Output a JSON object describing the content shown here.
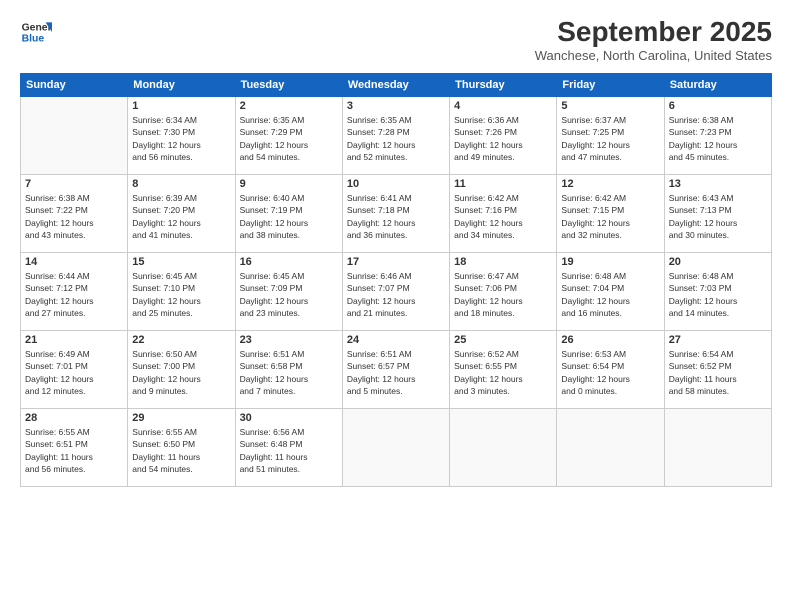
{
  "logo": {
    "line1": "General",
    "line2": "Blue"
  },
  "header": {
    "month": "September 2025",
    "location": "Wanchese, North Carolina, United States"
  },
  "weekdays": [
    "Sunday",
    "Monday",
    "Tuesday",
    "Wednesday",
    "Thursday",
    "Friday",
    "Saturday"
  ],
  "weeks": [
    [
      {
        "day": "",
        "info": ""
      },
      {
        "day": "1",
        "info": "Sunrise: 6:34 AM\nSunset: 7:30 PM\nDaylight: 12 hours\nand 56 minutes."
      },
      {
        "day": "2",
        "info": "Sunrise: 6:35 AM\nSunset: 7:29 PM\nDaylight: 12 hours\nand 54 minutes."
      },
      {
        "day": "3",
        "info": "Sunrise: 6:35 AM\nSunset: 7:28 PM\nDaylight: 12 hours\nand 52 minutes."
      },
      {
        "day": "4",
        "info": "Sunrise: 6:36 AM\nSunset: 7:26 PM\nDaylight: 12 hours\nand 49 minutes."
      },
      {
        "day": "5",
        "info": "Sunrise: 6:37 AM\nSunset: 7:25 PM\nDaylight: 12 hours\nand 47 minutes."
      },
      {
        "day": "6",
        "info": "Sunrise: 6:38 AM\nSunset: 7:23 PM\nDaylight: 12 hours\nand 45 minutes."
      }
    ],
    [
      {
        "day": "7",
        "info": "Sunrise: 6:38 AM\nSunset: 7:22 PM\nDaylight: 12 hours\nand 43 minutes."
      },
      {
        "day": "8",
        "info": "Sunrise: 6:39 AM\nSunset: 7:20 PM\nDaylight: 12 hours\nand 41 minutes."
      },
      {
        "day": "9",
        "info": "Sunrise: 6:40 AM\nSunset: 7:19 PM\nDaylight: 12 hours\nand 38 minutes."
      },
      {
        "day": "10",
        "info": "Sunrise: 6:41 AM\nSunset: 7:18 PM\nDaylight: 12 hours\nand 36 minutes."
      },
      {
        "day": "11",
        "info": "Sunrise: 6:42 AM\nSunset: 7:16 PM\nDaylight: 12 hours\nand 34 minutes."
      },
      {
        "day": "12",
        "info": "Sunrise: 6:42 AM\nSunset: 7:15 PM\nDaylight: 12 hours\nand 32 minutes."
      },
      {
        "day": "13",
        "info": "Sunrise: 6:43 AM\nSunset: 7:13 PM\nDaylight: 12 hours\nand 30 minutes."
      }
    ],
    [
      {
        "day": "14",
        "info": "Sunrise: 6:44 AM\nSunset: 7:12 PM\nDaylight: 12 hours\nand 27 minutes."
      },
      {
        "day": "15",
        "info": "Sunrise: 6:45 AM\nSunset: 7:10 PM\nDaylight: 12 hours\nand 25 minutes."
      },
      {
        "day": "16",
        "info": "Sunrise: 6:45 AM\nSunset: 7:09 PM\nDaylight: 12 hours\nand 23 minutes."
      },
      {
        "day": "17",
        "info": "Sunrise: 6:46 AM\nSunset: 7:07 PM\nDaylight: 12 hours\nand 21 minutes."
      },
      {
        "day": "18",
        "info": "Sunrise: 6:47 AM\nSunset: 7:06 PM\nDaylight: 12 hours\nand 18 minutes."
      },
      {
        "day": "19",
        "info": "Sunrise: 6:48 AM\nSunset: 7:04 PM\nDaylight: 12 hours\nand 16 minutes."
      },
      {
        "day": "20",
        "info": "Sunrise: 6:48 AM\nSunset: 7:03 PM\nDaylight: 12 hours\nand 14 minutes."
      }
    ],
    [
      {
        "day": "21",
        "info": "Sunrise: 6:49 AM\nSunset: 7:01 PM\nDaylight: 12 hours\nand 12 minutes."
      },
      {
        "day": "22",
        "info": "Sunrise: 6:50 AM\nSunset: 7:00 PM\nDaylight: 12 hours\nand 9 minutes."
      },
      {
        "day": "23",
        "info": "Sunrise: 6:51 AM\nSunset: 6:58 PM\nDaylight: 12 hours\nand 7 minutes."
      },
      {
        "day": "24",
        "info": "Sunrise: 6:51 AM\nSunset: 6:57 PM\nDaylight: 12 hours\nand 5 minutes."
      },
      {
        "day": "25",
        "info": "Sunrise: 6:52 AM\nSunset: 6:55 PM\nDaylight: 12 hours\nand 3 minutes."
      },
      {
        "day": "26",
        "info": "Sunrise: 6:53 AM\nSunset: 6:54 PM\nDaylight: 12 hours\nand 0 minutes."
      },
      {
        "day": "27",
        "info": "Sunrise: 6:54 AM\nSunset: 6:52 PM\nDaylight: 11 hours\nand 58 minutes."
      }
    ],
    [
      {
        "day": "28",
        "info": "Sunrise: 6:55 AM\nSunset: 6:51 PM\nDaylight: 11 hours\nand 56 minutes."
      },
      {
        "day": "29",
        "info": "Sunrise: 6:55 AM\nSunset: 6:50 PM\nDaylight: 11 hours\nand 54 minutes."
      },
      {
        "day": "30",
        "info": "Sunrise: 6:56 AM\nSunset: 6:48 PM\nDaylight: 11 hours\nand 51 minutes."
      },
      {
        "day": "",
        "info": ""
      },
      {
        "day": "",
        "info": ""
      },
      {
        "day": "",
        "info": ""
      },
      {
        "day": "",
        "info": ""
      }
    ]
  ]
}
